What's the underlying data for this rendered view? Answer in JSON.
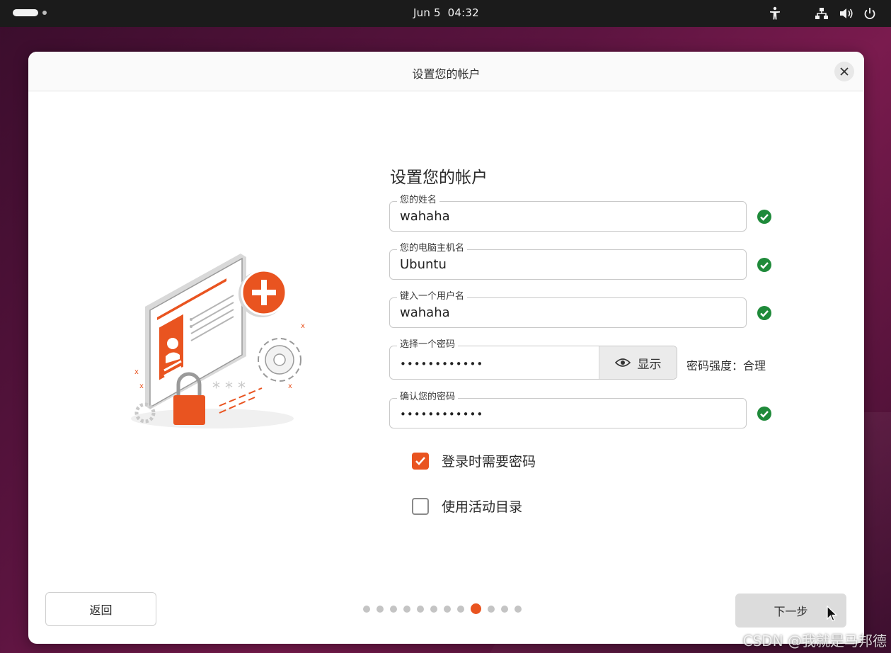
{
  "topbar": {
    "clock": "Jun 5  04:32",
    "tray_icons": [
      "accessibility-icon",
      "network-icon",
      "volume-icon",
      "power-icon"
    ]
  },
  "dialog": {
    "title": "设置您的帐户",
    "close_icon": "close-icon"
  },
  "form": {
    "heading": "设置您的帐户",
    "fields": [
      {
        "label": "您的姓名",
        "value": "wahaha",
        "valid": true
      },
      {
        "label": "您的电脑主机名",
        "value": "Ubuntu",
        "valid": true
      },
      {
        "label": "键入一个用户名",
        "value": "wahaha",
        "valid": true
      },
      {
        "label": "选择一个密码",
        "value": "••••••••••••"
      },
      {
        "label": "确认您的密码",
        "value": "••••••••••••",
        "valid": true
      }
    ],
    "show_button": "显示",
    "strength": "密码强度：合理",
    "checkboxes": [
      {
        "label": "登录时需要密码",
        "checked": true
      },
      {
        "label": "使用活动目录",
        "checked": false
      }
    ]
  },
  "footer": {
    "back": "返回",
    "next": "下一步",
    "pager": {
      "total": 12,
      "active": 8
    }
  },
  "watermark": "CSDN @我就是马邦德",
  "colors": {
    "accent": "#e95420",
    "ok": "#1f8a3a",
    "topbar": "#1b1b1b"
  }
}
